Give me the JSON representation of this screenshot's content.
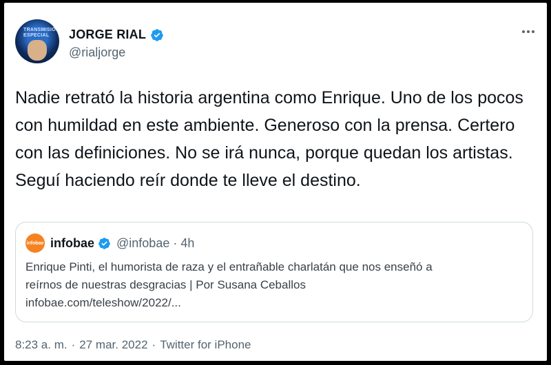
{
  "author": {
    "display_name": "JORGE RIAL",
    "handle": "@rialjorge",
    "avatar_text": "TRANSMISIÓN ESPECIAL",
    "verified": true
  },
  "tweet": {
    "text": "Nadie retrató la historia argentina como Enrique. Uno de los pocos con humildad en este ambiente. Generoso con la prensa. Certero con las definiciones. No se irá nunca, porque quedan los artistas. Seguí haciendo reír donde te lleve el destino."
  },
  "quote": {
    "avatar_text": "infobae",
    "display_name": "infobae",
    "handle": "@infobae",
    "separator": "·",
    "time": "4h",
    "body_line1": "Enrique Pinti, el humorista de raza y el entrañable charlatán que nos enseñó a",
    "body_line2": "reírnos de nuestras desgracias | Por Susana Ceballos",
    "body_line3": "infobae.com/teleshow/2022/..."
  },
  "footer": {
    "time": "8:23 a. m.",
    "date": "27 mar. 2022",
    "source": "Twitter for iPhone",
    "separator": "·"
  },
  "colors": {
    "verified_blue": "#1d9bf0",
    "text_primary": "#0f1419",
    "text_secondary": "#536471",
    "infobae_orange": "#f58220"
  },
  "icons": {
    "verified": "verified-badge-icon",
    "more": "more-horizontal-icon"
  }
}
